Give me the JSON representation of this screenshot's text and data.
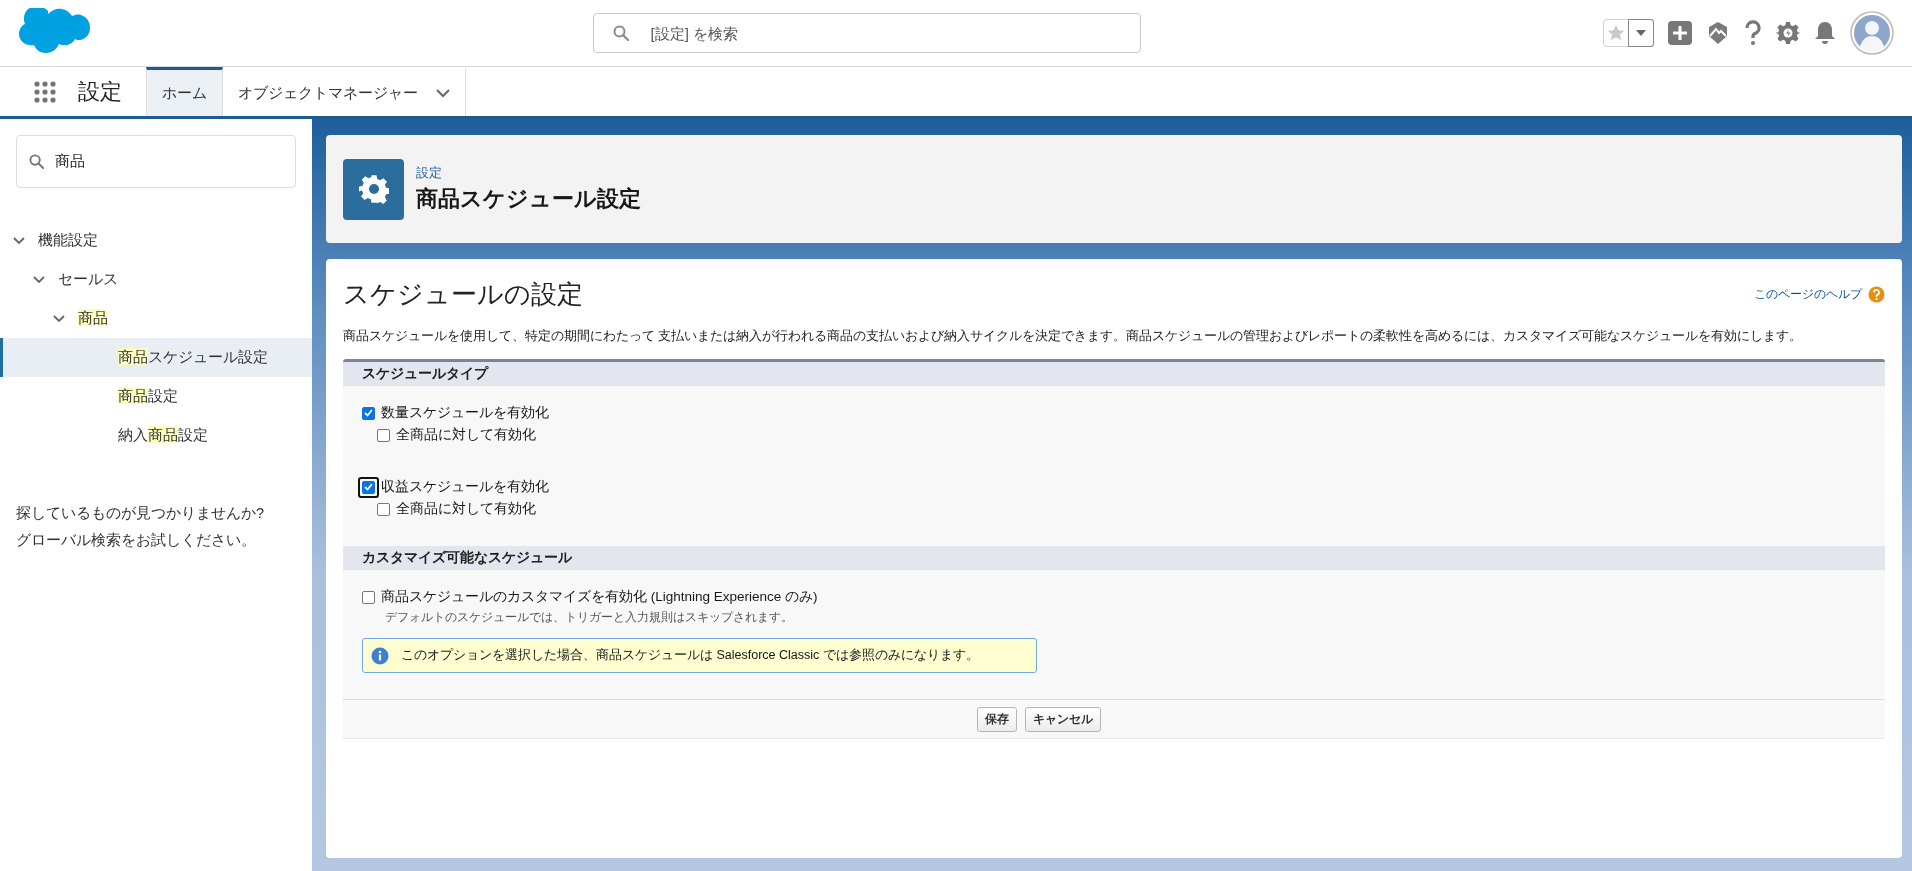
{
  "global_header": {
    "search": {
      "placeholder": "[設定] を検索"
    }
  },
  "nav": {
    "app_name": "設定",
    "tabs": [
      {
        "label": "ホーム",
        "selected": true,
        "has_menu": false
      },
      {
        "label": "オブジェクトマネージャー",
        "selected": false,
        "has_menu": true
      }
    ]
  },
  "sidebar": {
    "search": {
      "value": "商品"
    },
    "tree": [
      {
        "label_parts": [
          {
            "text": "機能設定",
            "highlighted": false
          }
        ],
        "expanded": true,
        "selected": false,
        "children": [
          {
            "label_parts": [
              {
                "text": "セールス",
                "highlighted": false
              }
            ],
            "expanded": true,
            "selected": false,
            "children": [
              {
                "label_parts": [
                  {
                    "text": "商品",
                    "highlighted": true
                  }
                ],
                "expanded": true,
                "selected": false,
                "children": [
                  {
                    "label_parts": [
                      {
                        "text": "商品",
                        "highlighted": true
                      },
                      {
                        "text": "スケジュール設定",
                        "highlighted": false
                      }
                    ],
                    "selected": true
                  },
                  {
                    "label_parts": [
                      {
                        "text": "商品",
                        "highlighted": true
                      },
                      {
                        "text": "設定",
                        "highlighted": false
                      }
                    ],
                    "selected": false
                  },
                  {
                    "label_parts": [
                      {
                        "text": "納入",
                        "highlighted": false
                      },
                      {
                        "text": "商品",
                        "highlighted": true
                      },
                      {
                        "text": "設定",
                        "highlighted": false
                      }
                    ],
                    "selected": false
                  }
                ]
              }
            ]
          }
        ]
      }
    ],
    "help_text_lines": [
      "探しているものが見つかりませんか?",
      "グローバル検索をお試しください。"
    ]
  },
  "page_header": {
    "breadcrumb": "設定",
    "title": "商品スケジュール設定"
  },
  "content": {
    "title": "スケジュールの設定",
    "help_link": "このページのヘルプ",
    "description": "商品スケジュールを使用して、特定の期間にわたって 支払いまたは納入が行われる商品の支払いおよび納入サイクルを決定できます。商品スケジュールの管理およびレポートの柔軟性を高めるには、カスタマイズ可能なスケジュールを有効にします。",
    "sections": [
      {
        "title": "スケジュールタイプ",
        "options": [
          {
            "label": "数量スケジュールを有効化",
            "checked": true,
            "focused": false,
            "children": [
              {
                "label": "全商品に対して有効化",
                "checked": false
              }
            ]
          },
          {
            "label": "収益スケジュールを有効化",
            "checked": true,
            "focused": true,
            "children": [
              {
                "label": "全商品に対して有効化",
                "checked": false
              }
            ]
          }
        ]
      },
      {
        "title": "カスタマイズ可能なスケジュール",
        "options": [
          {
            "label": "商品スケジュールのカスタマイズを有効化 (Lightning Experience のみ)",
            "checked": false,
            "focused": false,
            "hint": "デフォルトのスケジュールでは、トリガーと入力規則はスキップされます。"
          }
        ],
        "info": "このオプションを選択した場合、商品スケジュールは Salesforce Classic では参照のみになります。"
      }
    ],
    "buttons": [
      "保存",
      "キャンセル"
    ]
  }
}
